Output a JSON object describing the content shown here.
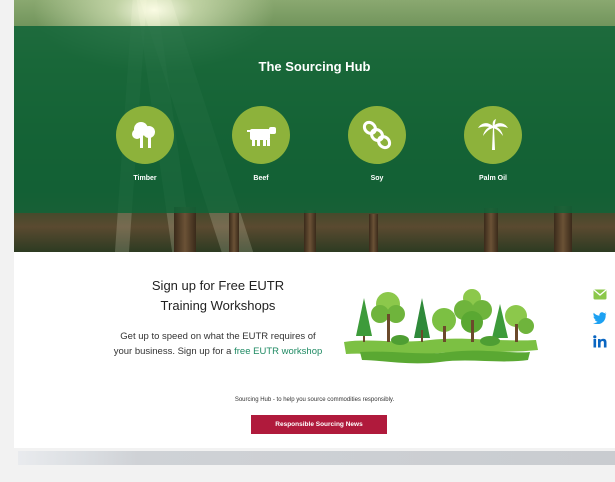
{
  "hub": {
    "title": "The Sourcing Hub",
    "commodities": [
      {
        "label": "Timber",
        "icon": "tree-icon"
      },
      {
        "label": "Beef",
        "icon": "cow-icon"
      },
      {
        "label": "Soy",
        "icon": "soy-icon"
      },
      {
        "label": "Palm Oil",
        "icon": "palm-tree-icon"
      }
    ]
  },
  "signup": {
    "title_line1": "Sign up for Free EUTR",
    "title_line2": "Training Workshops",
    "text_line1": "Get up to speed on what the EUTR requires of",
    "text_line2_prefix": "your business. Sign up for a ",
    "link_text": "free EUTR workshop"
  },
  "footer": {
    "tagline": "Sourcing Hub - to help you source commodities responsibly.",
    "news_button": "Responsible Sourcing News"
  },
  "colors": {
    "panel": "#106438",
    "circle": "#8db23b",
    "button": "#b01a3c",
    "link": "#1f8a63"
  }
}
